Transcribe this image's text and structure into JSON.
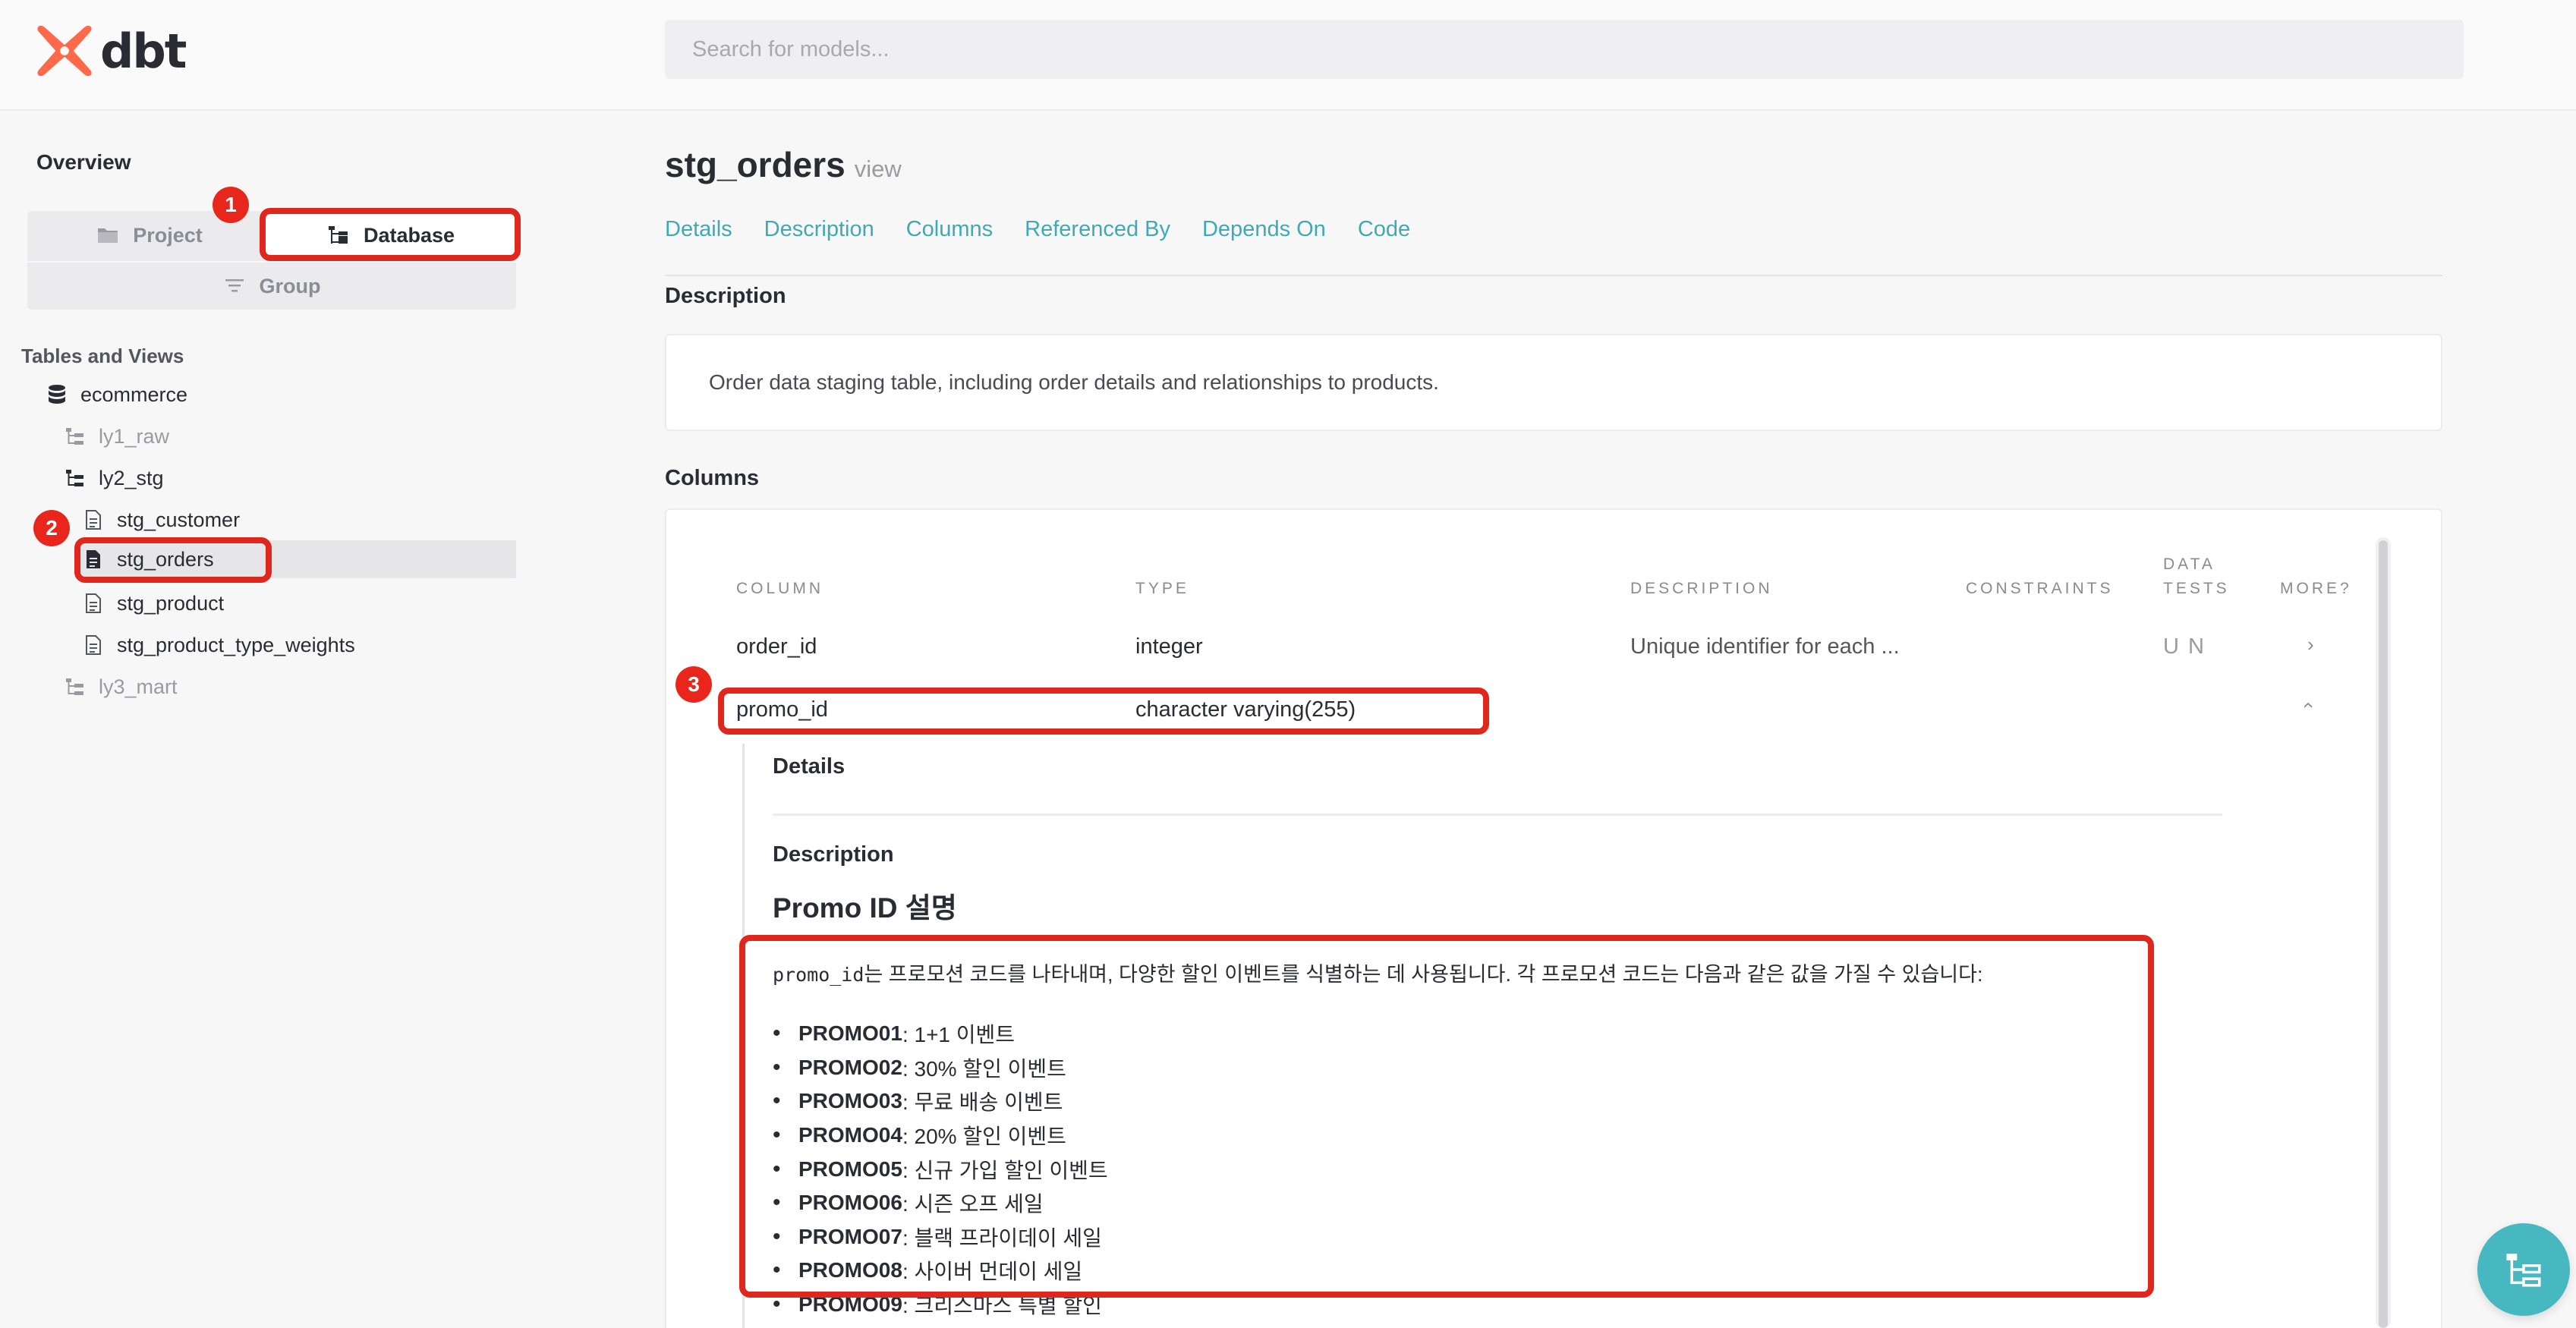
{
  "header": {
    "logo_text": "dbt",
    "search_placeholder": "Search for models..."
  },
  "sidebar": {
    "overview_label": "Overview",
    "tabs": {
      "project": "Project",
      "database": "Database",
      "group": "Group"
    },
    "section_title": "Tables and Views",
    "tree": {
      "database": "ecommerce",
      "schema1": "ly1_raw",
      "schema2": "ly2_stg",
      "models": [
        "stg_customer",
        "stg_orders",
        "stg_product",
        "stg_product_type_weights"
      ],
      "schema3": "ly3_mart"
    }
  },
  "annotations": {
    "marker1": "1",
    "marker2": "2",
    "marker3": "3"
  },
  "model": {
    "name": "stg_orders",
    "kind": "view",
    "tabs": [
      "Details",
      "Description",
      "Columns",
      "Referenced By",
      "Depends On",
      "Code"
    ],
    "description_heading": "Description",
    "description_text": "Order data staging table, including order details and relationships to products.",
    "columns_heading": "Columns"
  },
  "columns_table": {
    "headers": {
      "column": "COLUMN",
      "type": "TYPE",
      "description": "DESCRIPTION",
      "constraints": "CONSTRAINTS",
      "data_tests_1": "DATA",
      "data_tests_2": "TESTS",
      "more": "MORE?"
    },
    "rows": [
      {
        "column": "order_id",
        "type": "integer",
        "description": "Unique identifier for each ...",
        "tests": "U N",
        "more": "›"
      },
      {
        "column": "promo_id",
        "type": "character varying(255)",
        "description": "",
        "tests": "",
        "more": "‹"
      }
    ]
  },
  "expanded": {
    "details_heading": "Details",
    "description_heading": "Description",
    "md_heading": "Promo ID 설명",
    "md_code": "promo_id",
    "md_intro": "는 프로모션 코드를 나타내며, 다양한 할인 이벤트를 식별하는 데 사용됩니다. 각 프로모션 코드는 다음과 같은 값을 가질 수 있습니다:",
    "promos": [
      {
        "code": "PROMO01",
        "text": ": 1+1 이벤트"
      },
      {
        "code": "PROMO02",
        "text": ": 30% 할인 이벤트"
      },
      {
        "code": "PROMO03",
        "text": ": 무료 배송 이벤트"
      },
      {
        "code": "PROMO04",
        "text": ": 20% 할인 이벤트"
      },
      {
        "code": "PROMO05",
        "text": ": 신규 가입 할인 이벤트"
      },
      {
        "code": "PROMO06",
        "text": ": 시즌 오프 세일"
      },
      {
        "code": "PROMO07",
        "text": ": 블랙 프라이데이 세일"
      },
      {
        "code": "PROMO08",
        "text": ": 사이버 먼데이 세일"
      },
      {
        "code": "PROMO09",
        "text": ": 크리스마스 특별 할인"
      }
    ]
  },
  "colors": {
    "accent": "#3fa9b4",
    "logo": "#ff694b",
    "annotation_red": "#e0271d",
    "fab": "#47b8bf"
  },
  "icons": {
    "logo": "dbt-logo-icon",
    "project": "folder-icon",
    "database": "tree-icon",
    "group": "filter-lines-icon",
    "db": "database-icon",
    "schema": "schema-tree-icon",
    "model": "file-doc-icon",
    "fab": "lineage-icon"
  }
}
